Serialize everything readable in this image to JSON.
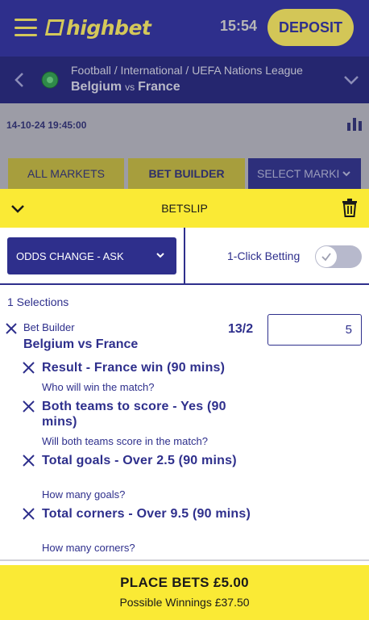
{
  "header": {
    "brand": "highbet",
    "time": "15:54",
    "deposit_label": "DEPOSIT"
  },
  "event": {
    "breadcrumb": "Football / International / UEFA Nations League",
    "home": "Belgium",
    "vs": "vs",
    "away": "France",
    "datetime": "14-10-24 19:45:00"
  },
  "tabs": {
    "all_markets": "ALL MARKETS",
    "bet_builder": "BET BUILDER",
    "select_market": "SELECT MARKI"
  },
  "betslip": {
    "title": "BETSLIP",
    "odds_change": "ODDS CHANGE - ASK",
    "one_click_label": "1-Click Betting",
    "one_click_enabled": false,
    "selections_count": "1 Selections",
    "bet_type": "Bet Builder",
    "match": "Belgium vs France",
    "odds": "13/2",
    "stake": "5",
    "legs": [
      {
        "title": "Result - France win (90 mins)",
        "question": "Who will win the match?"
      },
      {
        "title": "Both teams to score - Yes (90 mins)",
        "question": "Will both teams score in the match?"
      },
      {
        "title": "Total goals - Over 2.5 (90 mins)",
        "question": "How many goals?"
      },
      {
        "title": "Total corners - Over 9.5 (90 mins)",
        "question": "How many corners?"
      }
    ],
    "place_label": "PLACE BETS £5.00",
    "winnings": "Possible Winnings £37.50"
  },
  "colors": {
    "navy": "#2e2f8c",
    "yellow": "#faea35",
    "gold": "#d3c657"
  }
}
